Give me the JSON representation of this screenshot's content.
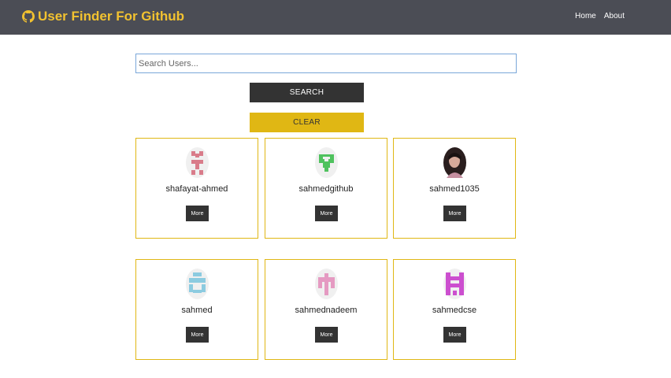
{
  "navbar": {
    "brand_icon": "github-icon",
    "brand_title": "User Finder For Github",
    "brand_color": "#f2c230",
    "links": [
      "Home",
      "About"
    ]
  },
  "search": {
    "placeholder": "Search Users...",
    "value": "",
    "search_label": "SEARCH",
    "clear_label": "CLEAR"
  },
  "users": [
    {
      "login": "shafayat-ahmed",
      "avatar_color": "#d97c8a",
      "more_label": "More"
    },
    {
      "login": "sahmedgithub",
      "avatar_color": "#4fc25e",
      "more_label": "More"
    },
    {
      "login": "sahmed1035",
      "avatar_color": "#3a2a2a",
      "more_label": "More"
    },
    {
      "login": "sahmed",
      "avatar_color": "#8ccbe0",
      "more_label": "More"
    },
    {
      "login": "sahmednadeem",
      "avatar_color": "#e59ac2",
      "more_label": "More"
    },
    {
      "login": "sahmedcse",
      "avatar_color": "#cc4fcf",
      "more_label": "More"
    }
  ]
}
